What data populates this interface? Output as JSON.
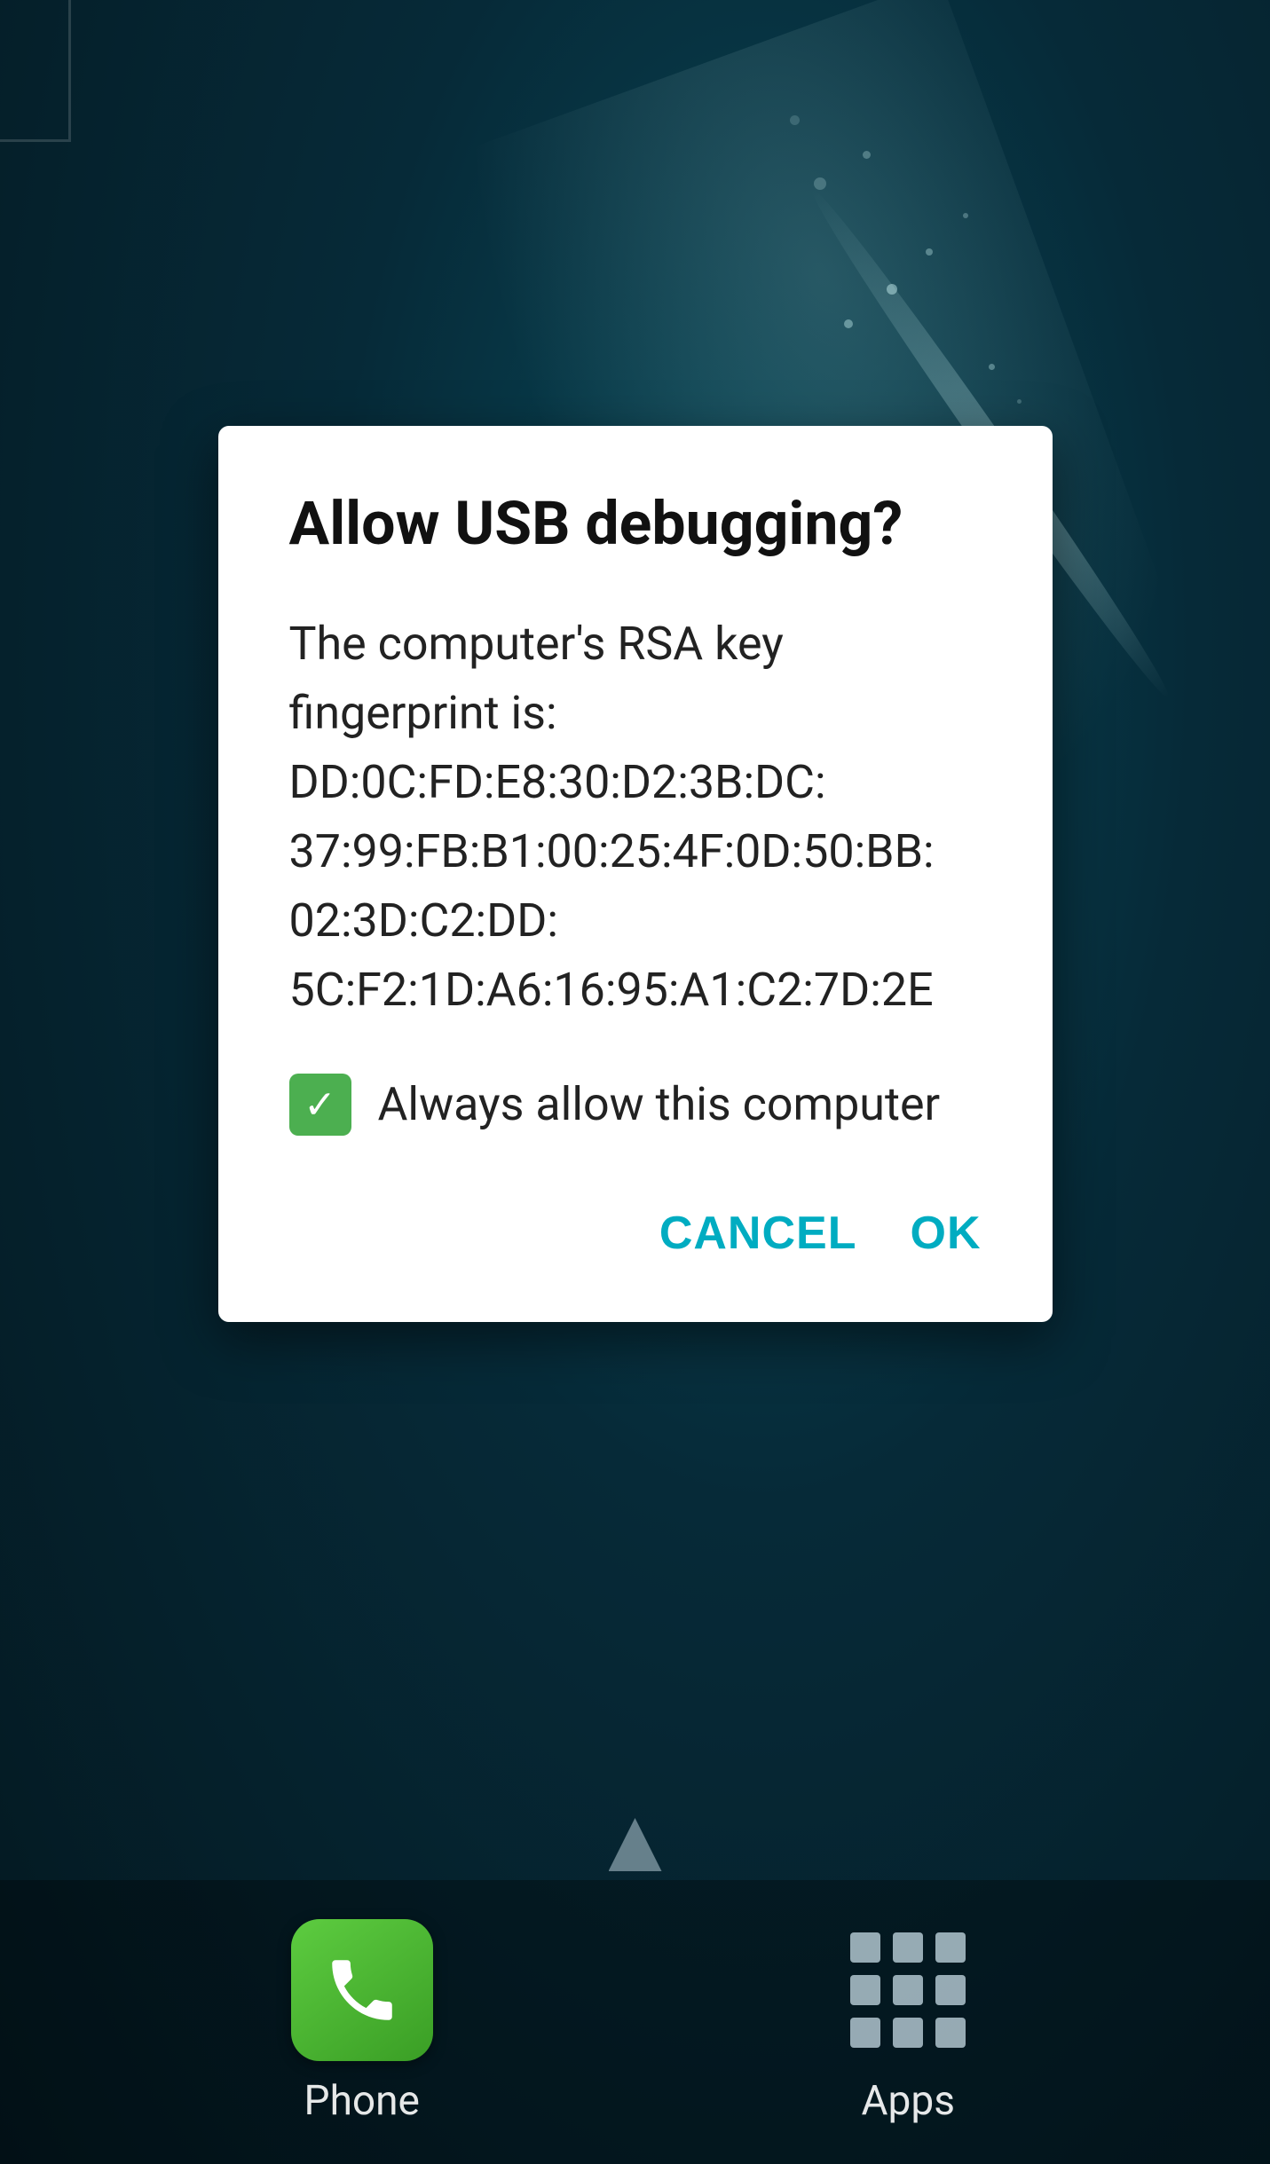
{
  "background": {
    "color": "#052030"
  },
  "dialog": {
    "title": "Allow USB debugging?",
    "body_text": "The computer's RSA key fingerprint is:\nDD:0C:FD:E8:30:D2:3B:DC:\n37:99:FB:B1:00:25:4F:0D:50:BB:\n02:3D:C2:DD:\n5C:F2:1D:A6:16:95:A1:C2:7D:2E",
    "checkbox_label": "Always allow this computer",
    "checkbox_checked": true,
    "cancel_button": "CANCEL",
    "ok_button": "OK"
  },
  "bottom_nav": {
    "phone_label": "Phone",
    "apps_label": "Apps"
  }
}
